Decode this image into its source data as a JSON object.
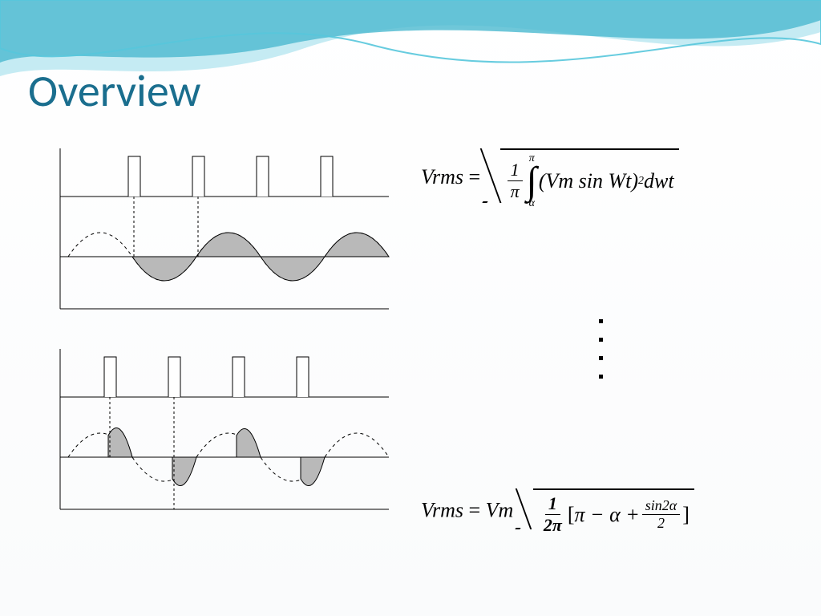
{
  "title": "Overview",
  "formula1": {
    "lhs": "Vrms",
    "eq": "=",
    "frac1_num": "1",
    "frac1_den": "π",
    "int_upper": "π",
    "int_lower": "α",
    "integrand_base": "(Vm sin Wt)",
    "integrand_exp": "2",
    "differential": " dwt"
  },
  "formula2": {
    "lhs": "Vrms ",
    "eq": "=",
    "coef": " Vm ",
    "frac_num": "1",
    "frac_den": "2π",
    "lbracket": "[",
    "term1": "π − α + ",
    "frac2_num": "sin2α",
    "frac2_den": "2",
    "rbracket": "]"
  },
  "diagrams": {
    "set": "two phase-controlled waveform groups: gate pulses above, chopped sine output below (shaded conduction regions), showing different firing angles"
  }
}
